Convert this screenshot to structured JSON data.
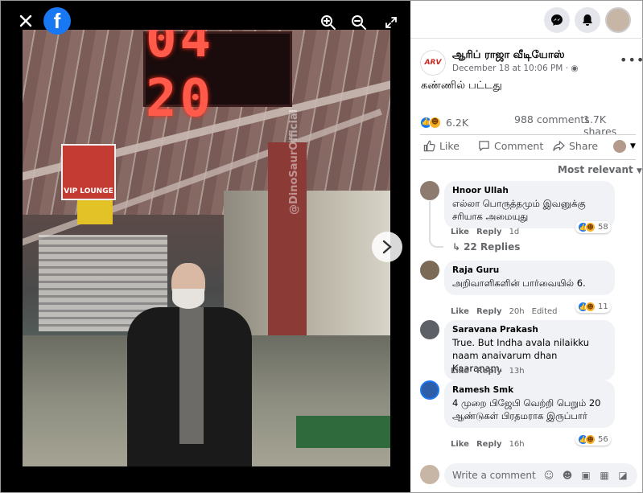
{
  "viewer": {
    "clock_text": "04 20",
    "vip_sign_text": "VIP LOUNGE",
    "watermark_text": "@DinoSaurOfficial",
    "icons": [
      "close-icon",
      "facebook-logo-icon",
      "zoom-in-icon",
      "zoom-out-icon",
      "expand-icon",
      "chevron-right-icon"
    ],
    "fb_letter": "f"
  },
  "post": {
    "page_name": "ஆரிப் ராஜா வீடியோஸ்",
    "avatar_text": "ARV",
    "time": "December 18 at 10:06 PM · ",
    "text": "கண்ணில் பட்டது",
    "reaction_count": "6.2K",
    "comments_count": "988 comments",
    "shares_count": "1.7K shares"
  },
  "actions": {
    "like": "Like",
    "comment": "Comment",
    "share": "Share"
  },
  "sort_label": "Most relevant",
  "comments": [
    {
      "name": "Hnoor Ullah",
      "text": "எல்லா பொருத்தமும் இவனுக்கு சரியாக அமையுது",
      "like": "Like",
      "reply": "Reply",
      "time": "1d",
      "edited": "",
      "reactions": "58"
    },
    {
      "name": "Raja Guru",
      "text": "அறிவாளிகளின் பார்வையில் 6.",
      "like": "Like",
      "reply": "Reply",
      "time": "20h",
      "edited": "Edited",
      "reactions": "11"
    },
    {
      "name": "Saravana Prakash",
      "text": "True. But Indha avala nilaikku naam anaivarum dhan Kaaranam.",
      "like": "Like",
      "reply": "Reply",
      "time": "13h",
      "edited": "",
      "reactions": ""
    },
    {
      "name": "Ramesh Smk",
      "text": "4 முறை பிஜேபி வெற்றி பெறும் 20 ஆண்டுகள் பிரதமராக இருப்பார்",
      "like": "Like",
      "reply": "Reply",
      "time": "16h",
      "edited": "",
      "reactions": "56"
    }
  ],
  "replies_label": "22 Replies",
  "composer": {
    "placeholder": "Write a comment..."
  },
  "colors": {
    "accent": "#1877f2",
    "haha": "#f7b125",
    "meta_text": "#65676b",
    "bubble": "#f0f2f5"
  }
}
